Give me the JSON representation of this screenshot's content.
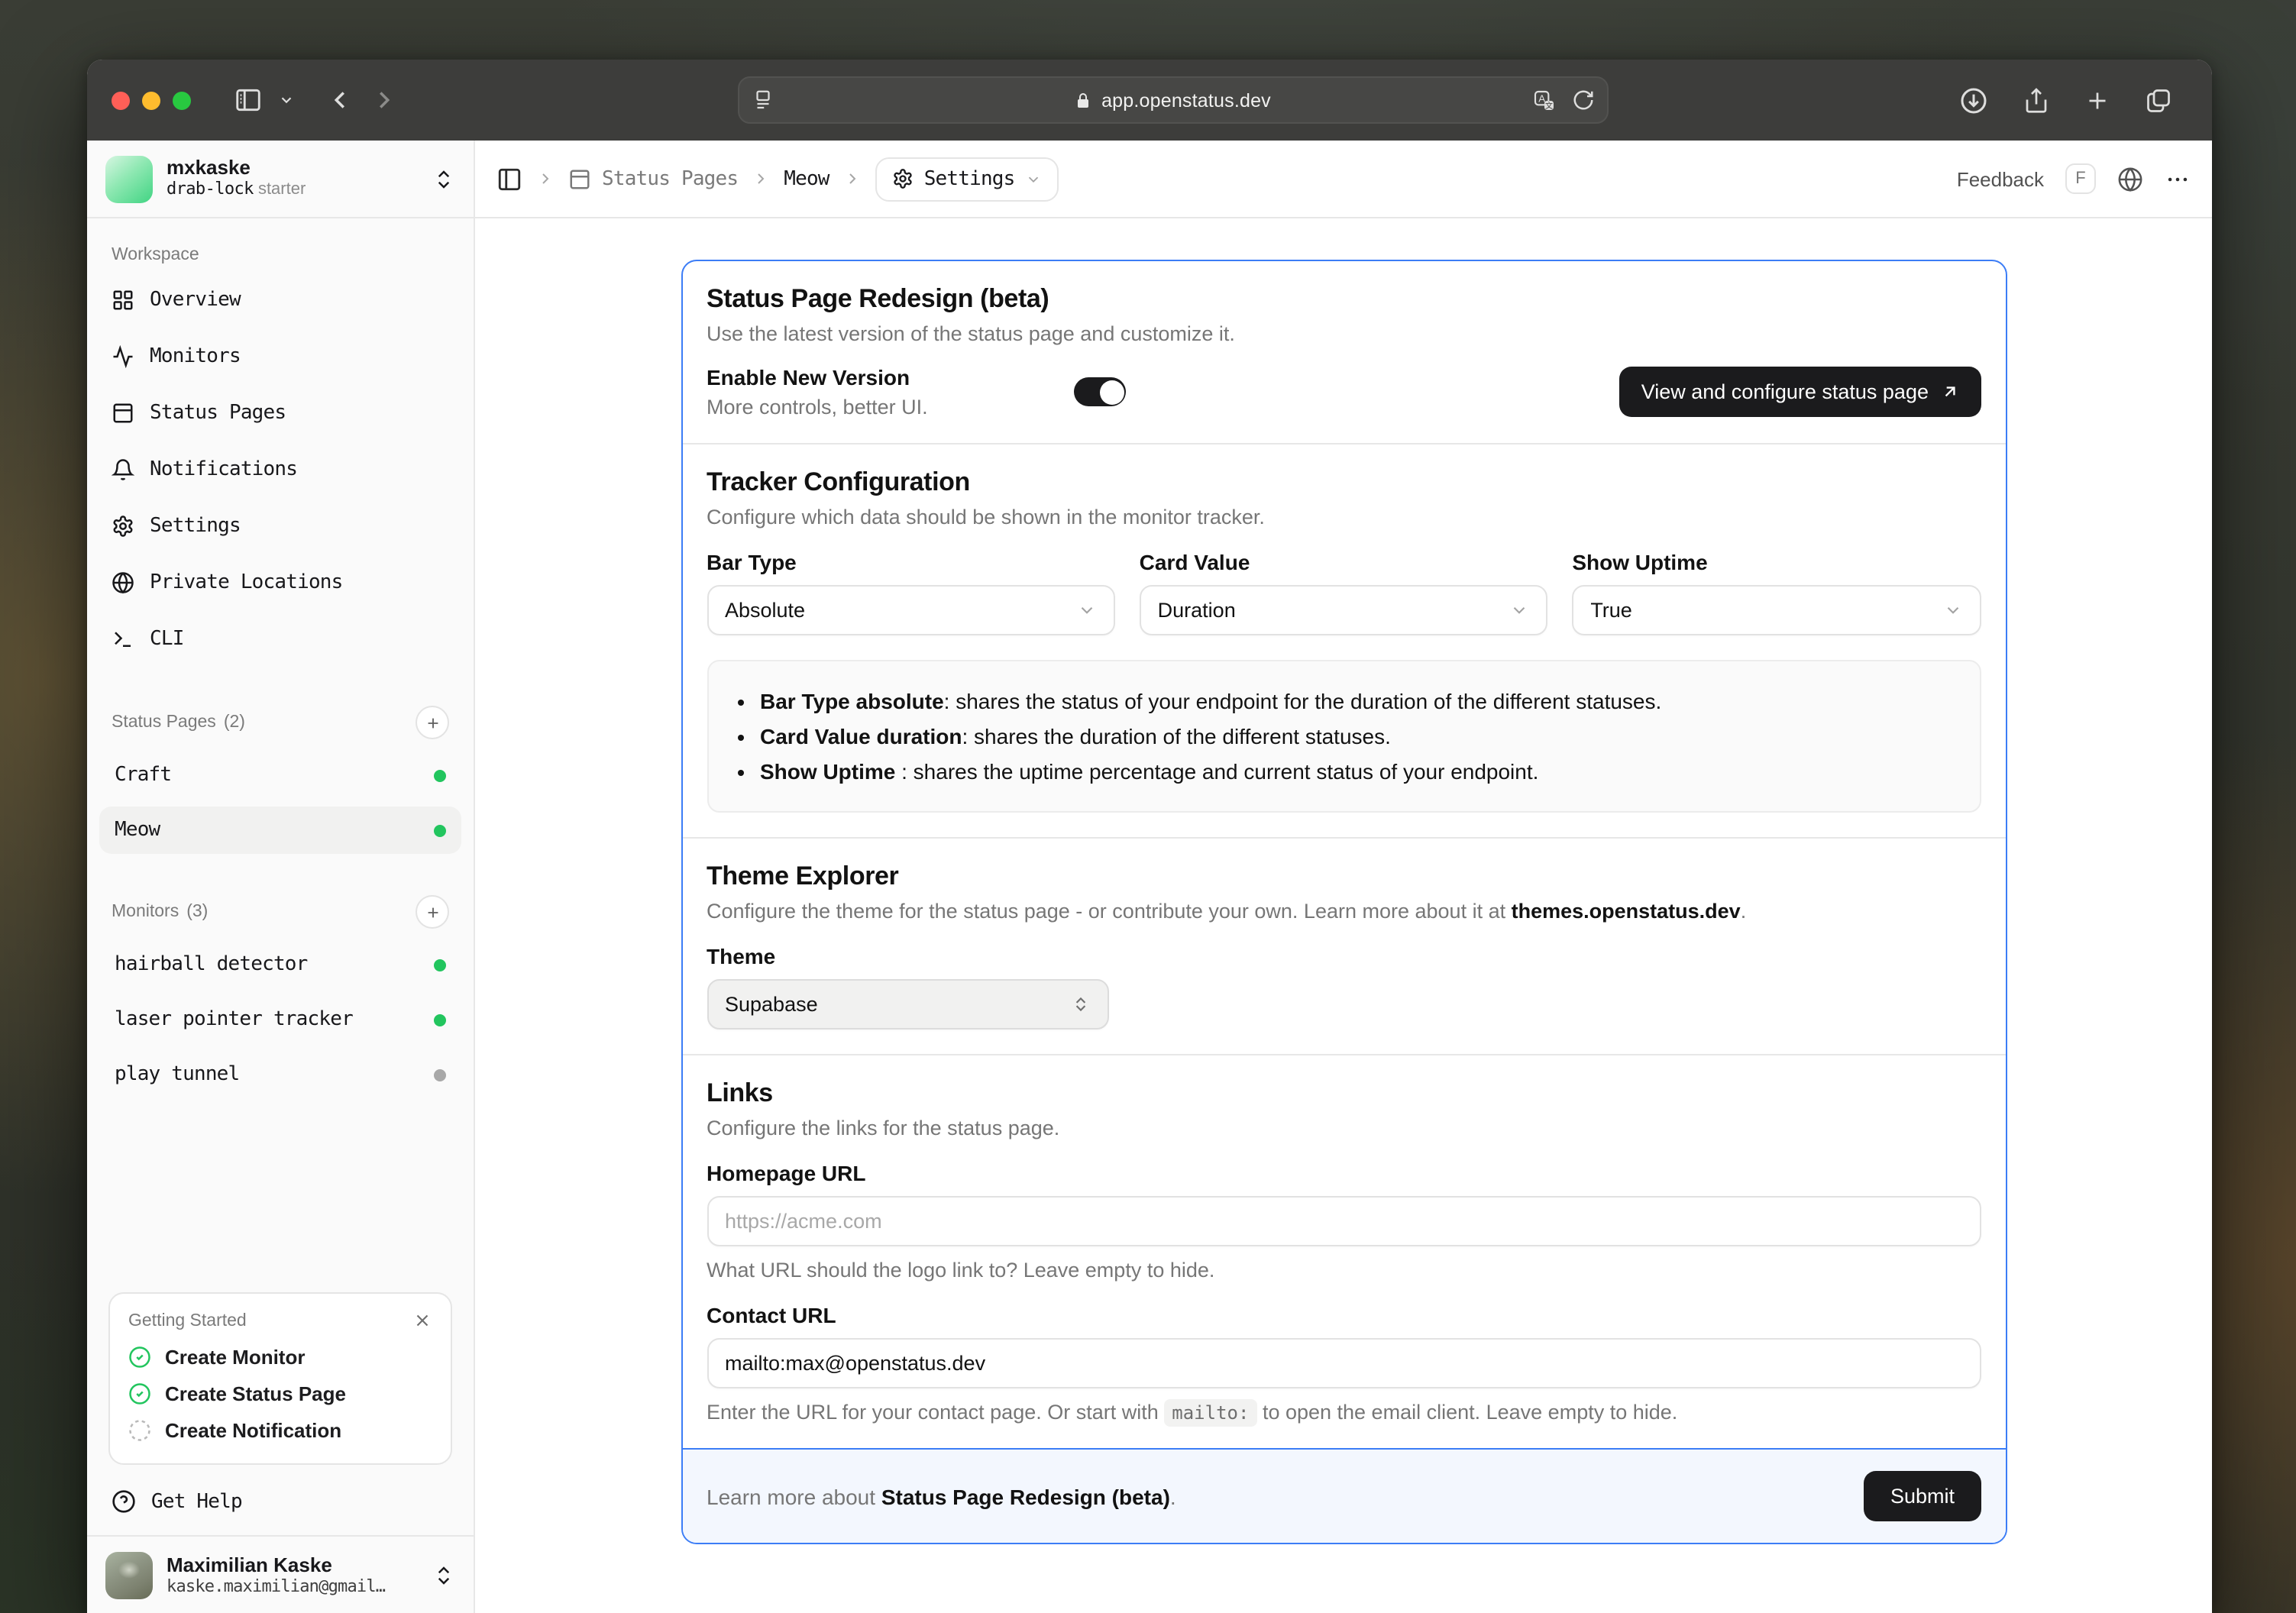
{
  "browser": {
    "url": "app.openstatus.dev",
    "icons": [
      "sidebar-toggle",
      "chevron-down",
      "back",
      "forward",
      "reader",
      "lock",
      "translate",
      "reload",
      "downloads",
      "share",
      "new-tab",
      "tab-overview"
    ]
  },
  "sidebar": {
    "workspace": {
      "name": "mxkaske",
      "slug": "drab-lock",
      "plan": "starter"
    },
    "nav_label": "Workspace",
    "nav": [
      {
        "label": "Overview",
        "icon": "layout-grid-icon"
      },
      {
        "label": "Monitors",
        "icon": "activity-icon"
      },
      {
        "label": "Status Pages",
        "icon": "panel-top-icon"
      },
      {
        "label": "Notifications",
        "icon": "bell-icon"
      },
      {
        "label": "Settings",
        "icon": "gear-icon"
      },
      {
        "label": "Private Locations",
        "icon": "globe-icon"
      },
      {
        "label": "CLI",
        "icon": "terminal-icon"
      }
    ],
    "status_pages": {
      "label": "Status Pages",
      "count": "(2)",
      "items": [
        {
          "label": "Craft",
          "status": "operational"
        },
        {
          "label": "Meow",
          "status": "operational",
          "active": true
        }
      ]
    },
    "monitors": {
      "label": "Monitors",
      "count": "(3)",
      "items": [
        {
          "label": "hairball detector",
          "status": "active"
        },
        {
          "label": "laser pointer tracker",
          "status": "active"
        },
        {
          "label": "play tunnel",
          "status": "inactive"
        }
      ]
    },
    "getting_started": {
      "title": "Getting Started",
      "items": [
        {
          "label": "Create Monitor",
          "done": true
        },
        {
          "label": "Create Status Page",
          "done": true
        },
        {
          "label": "Create Notification",
          "done": false
        }
      ]
    },
    "get_help": "Get Help",
    "user": {
      "name": "Maximilian Kaske",
      "email": "kaske.maximilian@gmail…"
    }
  },
  "header": {
    "breadcrumb": {
      "root": "Status Pages",
      "page": "Meow",
      "current": "Settings"
    },
    "feedback": "Feedback",
    "feedback_key": "F"
  },
  "main": {
    "card": {
      "beta": {
        "title": "Status Page Redesign (beta)",
        "description": "Use the latest version of the status page and customize it.",
        "field_label": "Enable New Version",
        "field_description": "More controls, better UI.",
        "toggle_on": true,
        "button": "View and configure status page"
      },
      "tracker": {
        "title": "Tracker Configuration",
        "description": "Configure which data should be shown in the monitor tracker.",
        "fields": [
          {
            "label": "Bar Type",
            "value": "Absolute"
          },
          {
            "label": "Card Value",
            "value": "Duration"
          },
          {
            "label": "Show Uptime",
            "value": "True"
          }
        ],
        "notes": [
          {
            "bold": "Bar Type absolute",
            "text": ": shares the status of your endpoint for the duration of the different statuses."
          },
          {
            "bold": "Card Value duration",
            "text": ": shares the duration of the different statuses."
          },
          {
            "bold": "Show Uptime",
            "text": " : shares the uptime percentage and current status of your endpoint."
          }
        ]
      },
      "theme": {
        "title": "Theme Explorer",
        "description_pre": "Configure the theme for the status page - or contribute your own. Learn more about it at ",
        "description_bold": "themes.openstatus.dev",
        "description_post": ".",
        "field_label": "Theme",
        "value": "Supabase"
      },
      "links": {
        "title": "Links",
        "description": "Configure the links for the status page.",
        "homepage_label": "Homepage URL",
        "homepage_placeholder": "https://acme.com",
        "homepage_hint": "What URL should the logo link to? Leave empty to hide.",
        "contact_label": "Contact URL",
        "contact_value": "mailto:max@openstatus.dev",
        "contact_hint_pre": "Enter the URL for your contact page. Or start with ",
        "contact_hint_code": "mailto:",
        "contact_hint_post": " to open the email client. Leave empty to hide."
      },
      "footer": {
        "text_pre": "Learn more about ",
        "text_bold": "Status Page Redesign (beta)",
        "text_post": ".",
        "submit": "Submit"
      }
    }
  },
  "colors": {
    "accent_blue": "#3c7df6",
    "status_green": "#22c55e",
    "status_gray": "#a8a8a8",
    "footer_bg": "#f3f7fe"
  }
}
